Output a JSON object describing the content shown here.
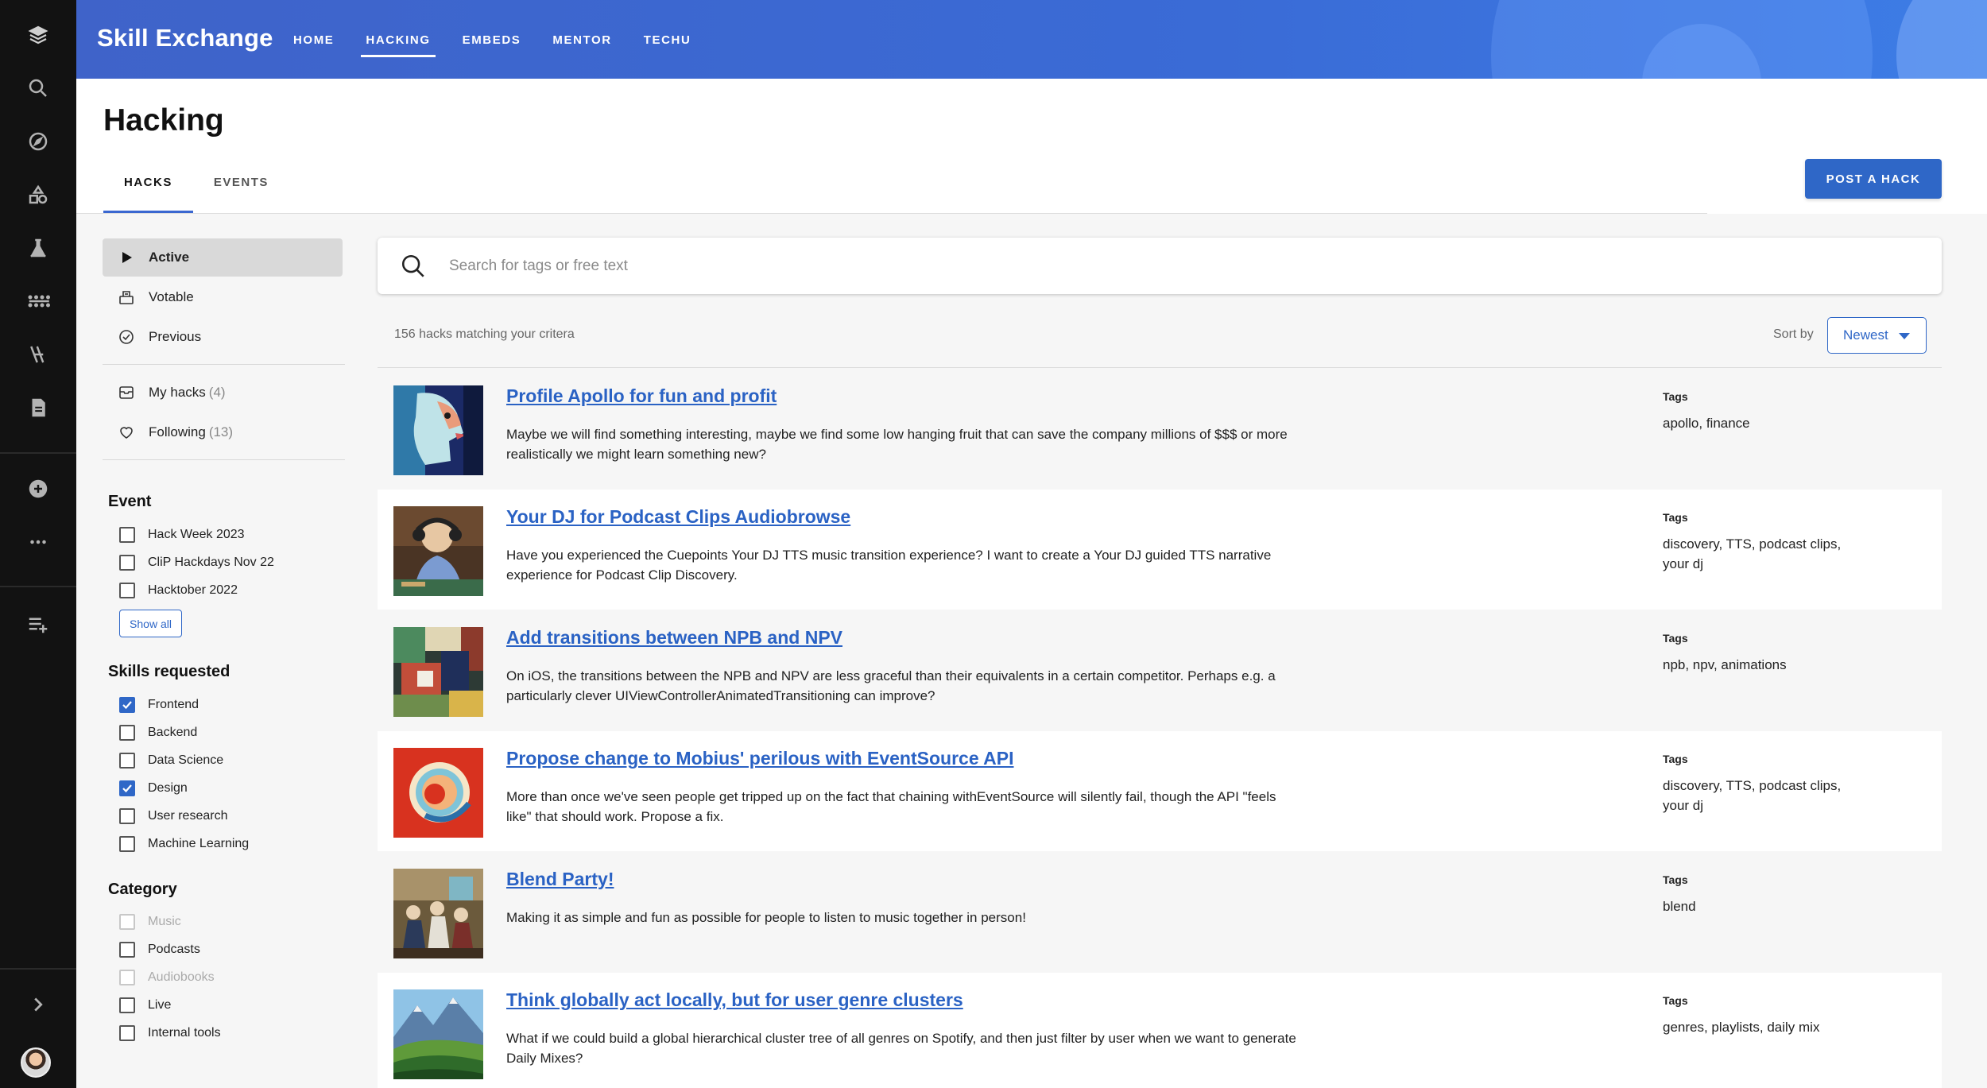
{
  "app": {
    "title": "Skill Exchange"
  },
  "nav": {
    "items": [
      {
        "label": "HOME"
      },
      {
        "label": "HACKING"
      },
      {
        "label": "EMBEDS"
      },
      {
        "label": "MENTOR"
      },
      {
        "label": "TECHU"
      }
    ],
    "active": "HACKING"
  },
  "rail": {
    "icons": [
      "library-icon",
      "search-icon",
      "compass-icon",
      "shapes-icon",
      "flask-icon",
      "dots-grid-icon",
      "lightning-icon",
      "document-icon",
      "add-circle-icon",
      "more-icon",
      "add-to-playlist-icon",
      "chevron-right-icon",
      "avatar"
    ]
  },
  "page": {
    "title": "Hacking"
  },
  "tabs": [
    {
      "label": "HACKS"
    },
    {
      "label": "EVENTS"
    }
  ],
  "post_button": {
    "label": "POST A HACK"
  },
  "sidebar": {
    "filters": [
      {
        "label": "Active",
        "icon": "play-icon",
        "active": true
      },
      {
        "label": "Votable",
        "icon": "ballot-icon"
      },
      {
        "label": "Previous",
        "icon": "check-circle-icon"
      }
    ],
    "mine": [
      {
        "label": "My hacks",
        "count": "(4)",
        "icon": "inbox-icon"
      },
      {
        "label": "Following",
        "count": "(13)",
        "icon": "heart-icon"
      }
    ],
    "event": {
      "title": "Event",
      "options": [
        "Hack Week 2023",
        "CliP Hackdays Nov 22",
        "Hacktober 2022"
      ],
      "show_all": "Show all"
    },
    "skills": {
      "title": "Skills requested",
      "options": [
        {
          "label": "Frontend",
          "checked": true
        },
        {
          "label": "Backend",
          "checked": false
        },
        {
          "label": "Data Science",
          "checked": false
        },
        {
          "label": "Design",
          "checked": true
        },
        {
          "label": "User research",
          "checked": false
        },
        {
          "label": "Machine Learning",
          "checked": false
        }
      ]
    },
    "category": {
      "title": "Category",
      "options": [
        {
          "label": "Music",
          "disabled": true
        },
        {
          "label": "Podcasts",
          "disabled": false
        },
        {
          "label": "Audiobooks",
          "disabled": true
        },
        {
          "label": "Live",
          "disabled": false
        },
        {
          "label": "Internal tools",
          "disabled": false
        }
      ]
    }
  },
  "search": {
    "placeholder": "Search for tags or free text",
    "value": ""
  },
  "results": {
    "count_text": "156 hacks matching your critera"
  },
  "sort": {
    "label": "Sort by",
    "value": "Newest"
  },
  "hacks": [
    {
      "title": "Profile Apollo for fun and profit",
      "description": "Maybe we will find something interesting, maybe we find some low hanging fruit that can save the company millions of $$$ or more realistically we might learn something new?",
      "tags_label": "Tags",
      "tags": "apollo, finance"
    },
    {
      "title": "Your DJ for Podcast Clips Audiobrowse",
      "description": "Have you experienced the Cuepoints Your DJ TTS music transition experience? I want to create a Your DJ guided TTS narrative experience for Podcast Clip Discovery.",
      "tags_label": "Tags",
      "tags": "discovery, TTS, podcast clips, your dj"
    },
    {
      "title": "Add transitions between NPB and NPV",
      "description": "On iOS, the transitions between the NPB and NPV are less graceful than their equivalents in a certain competitor. Perhaps e.g. a particularly clever UIViewControllerAnimatedTransitioning can improve?",
      "tags_label": "Tags",
      "tags": "npb, npv, animations"
    },
    {
      "title": "Propose change to Mobius' perilous with EventSource API",
      "description": "More than once we've seen people get tripped up on the fact that chaining withEventSource will silently fail, though the API \"feels like\" that should work. Propose a fix.",
      "tags_label": "Tags",
      "tags": "discovery, TTS, podcast clips, your dj"
    },
    {
      "title": "Blend Party!",
      "description": "Making it as simple and fun as possible for people to listen to music together in person!",
      "tags_label": "Tags",
      "tags": "blend"
    },
    {
      "title": "Think globally act locally, but for user genre clusters",
      "description": "What if we could build a global hierarchical cluster tree of all genres on Spotify, and then just filter by user when we want to generate Daily Mixes?",
      "tags_label": "Tags",
      "tags": "genres, playlists, daily mix"
    }
  ],
  "colors": {
    "accent": "#2f67c7",
    "header": "#3a6bd6",
    "rail": "#121212"
  }
}
